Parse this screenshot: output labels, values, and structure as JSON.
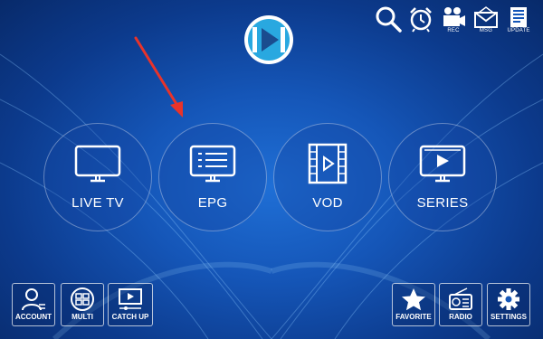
{
  "top_bar": {
    "icons": [
      {
        "icon": "search-icon",
        "label": ""
      },
      {
        "icon": "alarm-icon",
        "label": ""
      },
      {
        "icon": "record-icon",
        "label": "REC"
      },
      {
        "icon": "message-icon",
        "label": "MSG"
      },
      {
        "icon": "update-icon",
        "label": "UPDATE"
      }
    ]
  },
  "logo": {
    "icon": "play-logo-icon"
  },
  "main_tiles": [
    {
      "label": "LIVE TV",
      "icon": "tv-icon"
    },
    {
      "label": "EPG",
      "icon": "epg-icon"
    },
    {
      "label": "VOD",
      "icon": "film-icon"
    },
    {
      "label": "SERIES",
      "icon": "series-icon"
    }
  ],
  "bottom_left": [
    {
      "label": "ACCOUNT",
      "icon": "account-icon"
    },
    {
      "label": "MULTI",
      "icon": "multi-screen-icon"
    },
    {
      "label": "CATCH UP",
      "icon": "catch-up-icon"
    }
  ],
  "bottom_right": [
    {
      "label": "FAVORITE",
      "icon": "star-icon"
    },
    {
      "label": "RADIO",
      "icon": "radio-icon"
    },
    {
      "label": "SETTINGS",
      "icon": "gear-icon"
    }
  ],
  "annotation": {
    "icon": "red-arrow-icon",
    "color": "#e8332a"
  },
  "colors": {
    "background": "#1556b8",
    "logo_accent": "#29a8e0",
    "text": "#ffffff"
  }
}
